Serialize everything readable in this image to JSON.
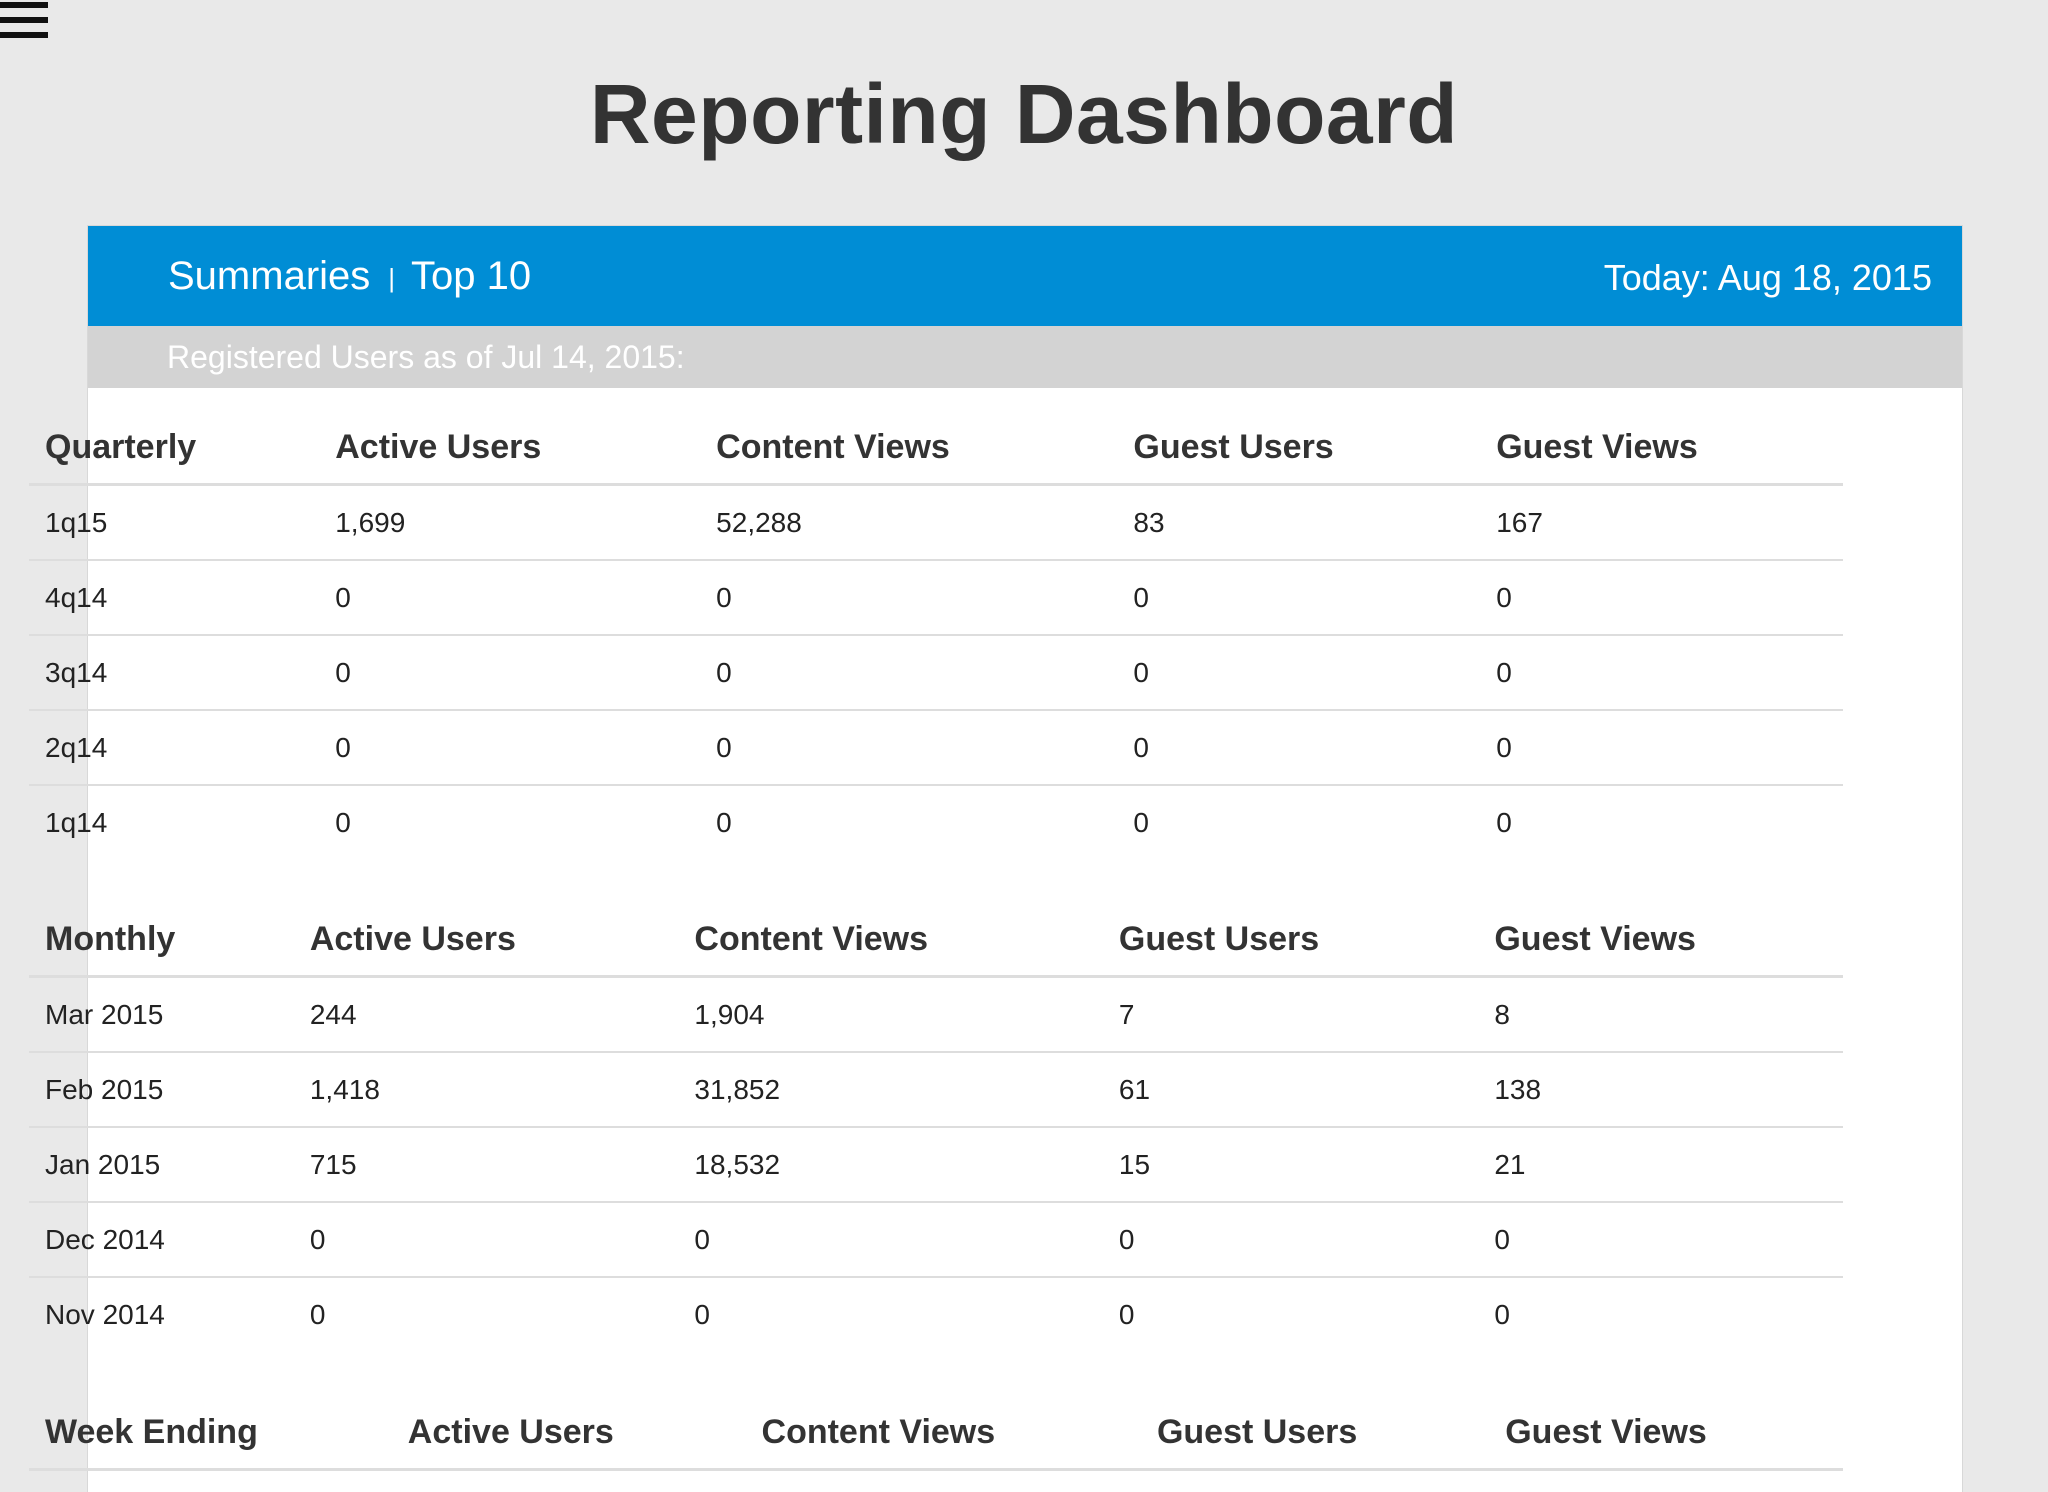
{
  "page": {
    "title": "Reporting Dashboard"
  },
  "nav": {
    "summaries": "Summaries",
    "separator": "|",
    "top10": "Top 10"
  },
  "header": {
    "today": "Today: Aug 18, 2015"
  },
  "registered": {
    "label": "Registered Users as of Jul 14, 2015:"
  },
  "icons": {
    "menu": "hamburger-menu-icon"
  },
  "colors": {
    "accent": "#008dd5",
    "subheader": "#d3d3d3",
    "background": "#e9e9e9"
  },
  "quarterly": {
    "headers": [
      "Quarterly",
      "Active Users",
      "Content Views",
      "Guest Users",
      "Guest Views"
    ],
    "rows": [
      [
        "1q15",
        "1,699",
        "52,288",
        "83",
        "167"
      ],
      [
        "4q14",
        "0",
        "0",
        "0",
        "0"
      ],
      [
        "3q14",
        "0",
        "0",
        "0",
        "0"
      ],
      [
        "2q14",
        "0",
        "0",
        "0",
        "0"
      ],
      [
        "1q14",
        "0",
        "0",
        "0",
        "0"
      ]
    ]
  },
  "monthly": {
    "headers": [
      "Monthly",
      "Active Users",
      "Content Views",
      "Guest Users",
      "Guest Views"
    ],
    "rows": [
      [
        "Mar 2015",
        "244",
        "1,904",
        "7",
        "8"
      ],
      [
        "Feb 2015",
        "1,418",
        "31,852",
        "61",
        "138"
      ],
      [
        "Jan 2015",
        "715",
        "18,532",
        "15",
        "21"
      ],
      [
        "Dec 2014",
        "0",
        "0",
        "0",
        "0"
      ],
      [
        "Nov 2014",
        "0",
        "0",
        "0",
        "0"
      ]
    ]
  },
  "weekly": {
    "headers": [
      "Week Ending",
      "Active Users",
      "Content Views",
      "Guest Users",
      "Guest Views"
    ],
    "rows": []
  }
}
